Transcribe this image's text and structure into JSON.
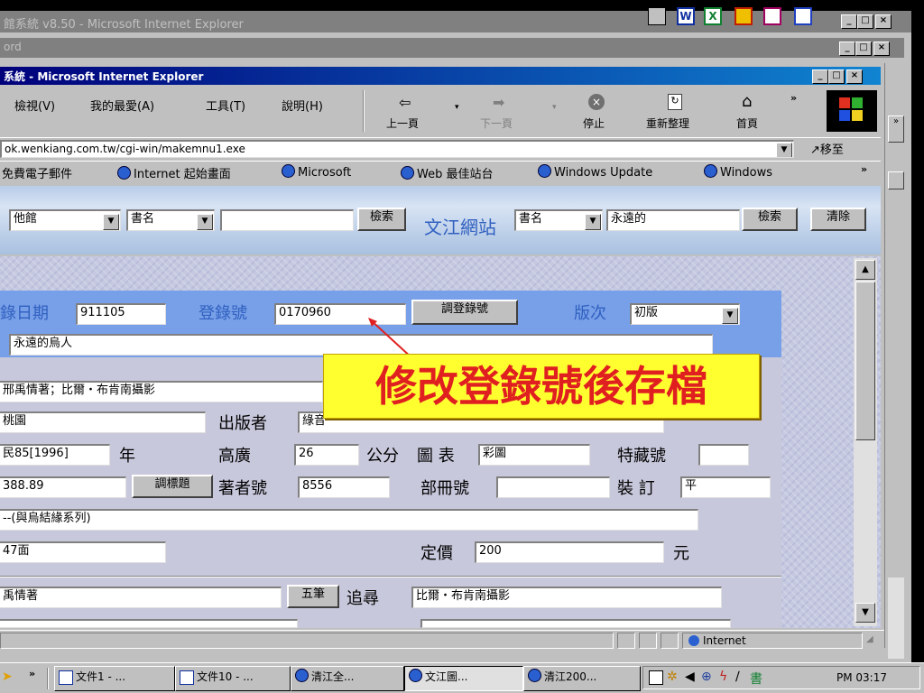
{
  "outer_window": {
    "title": "館系統 v8.50 - Microsoft Internet Explorer"
  },
  "second_window": {
    "title": "ord"
  },
  "ie_window": {
    "title": "系統 - Microsoft Internet Explorer"
  },
  "menu": [
    "檢視(V)",
    "我的最愛(A)",
    "工具(T)",
    "說明(H)"
  ],
  "toolbar": {
    "back": "上一頁",
    "forward": "下一頁",
    "stop": "停止",
    "refresh": "重新整理",
    "home": "首頁"
  },
  "address": {
    "value": "ok.wenkiang.com.tw/cgi-win/makemnu1.exe",
    "go_label": "移至"
  },
  "links": [
    "免費電子郵件",
    "Internet 起始畫面",
    "Microsoft",
    "Web 最佳站台",
    "Windows Update",
    "Windows"
  ],
  "search_bar": {
    "library_select": "他館",
    "field_select": "書名",
    "input_value": "",
    "search_button": "檢索",
    "site_label": "文江網站",
    "site_field_select": "書名",
    "site_input_value": "永遠的",
    "site_search_button": "檢索",
    "clear_button": "清除"
  },
  "form": {
    "reg_date_label": "錄日期",
    "reg_date_value": "911105",
    "reg_no_label": "登錄號",
    "reg_no_value": "0170960",
    "change_reg_button": "調登錄號",
    "edition_label": "版次",
    "edition_value": "初版",
    "title_value": "永遠的烏人",
    "author_value": "邢禹情著；比爾・布肯南攝影",
    "place_value": "桃園",
    "publisher_label": "出版者",
    "publisher_value": "綠音",
    "year_value": "民85[1996]",
    "year_label": "年",
    "height_label": "高廣",
    "height_value": "26",
    "height_unit": "公分",
    "illus_label": "圖 表",
    "illus_value": "彩圖",
    "special_label": "特藏號",
    "special_value": "",
    "class_value": "388.89",
    "change_title_button": "調標題",
    "author_no_label": "著者號",
    "author_no_value": "8556",
    "volume_label": "部冊號",
    "volume_value": "",
    "binding_label": "裝 訂",
    "binding_value": "平",
    "series_value": "--(與烏結緣系列)",
    "pages_value": "47面",
    "price_label": "定價",
    "price_value": "200",
    "price_unit": "元",
    "author2_value": "禹情著",
    "five_button": "五筆",
    "trace_label": "追尋",
    "trace_value": "比爾・布肯南攝影"
  },
  "callout": {
    "text": "修改登錄號後存檔",
    "text_color": "#e02020",
    "bg_color": "#ffff30"
  },
  "status_bar": {
    "zone": "Internet"
  },
  "taskbar": {
    "tasks": [
      "文件1 - ...",
      "文件10 - ...",
      "清江全...",
      "文江圖...",
      "清江200..."
    ],
    "clock": "PM 03:17"
  }
}
